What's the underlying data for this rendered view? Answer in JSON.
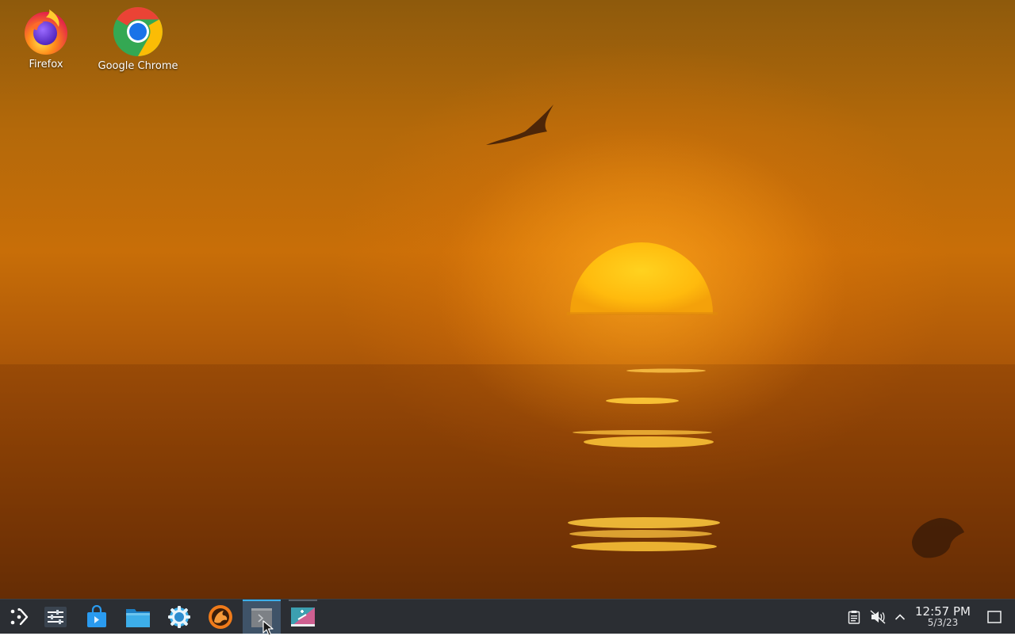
{
  "desktop": {
    "icons": [
      {
        "label": "Firefox",
        "icon": "firefox-icon"
      },
      {
        "label": "Google Chrome",
        "icon": "chrome-icon"
      }
    ]
  },
  "taskbar": {
    "launchers": [
      {
        "icon": "application-launcher-icon",
        "state": "idle"
      },
      {
        "icon": "system-settings-sliders-icon",
        "state": "idle"
      },
      {
        "icon": "discover-store-icon",
        "state": "idle"
      },
      {
        "icon": "file-manager-folder-icon",
        "state": "idle"
      },
      {
        "icon": "settings-gear-icon",
        "state": "idle"
      },
      {
        "icon": "lutris-icon",
        "state": "idle"
      },
      {
        "icon": "terminal-icon",
        "state": "active"
      },
      {
        "icon": "installer-app-icon",
        "state": "running"
      }
    ],
    "tray": [
      {
        "icon": "clipboard-icon"
      },
      {
        "icon": "volume-muted-icon"
      },
      {
        "icon": "chevron-up-icon"
      }
    ],
    "clock": {
      "time": "12:57 PM",
      "date": "5/3/23"
    },
    "show_desktop_icon": "show-desktop-icon"
  },
  "colors": {
    "taskbar_bg": "#2b2e33",
    "active_accent": "#3daee9",
    "sun": "#ffc414"
  }
}
